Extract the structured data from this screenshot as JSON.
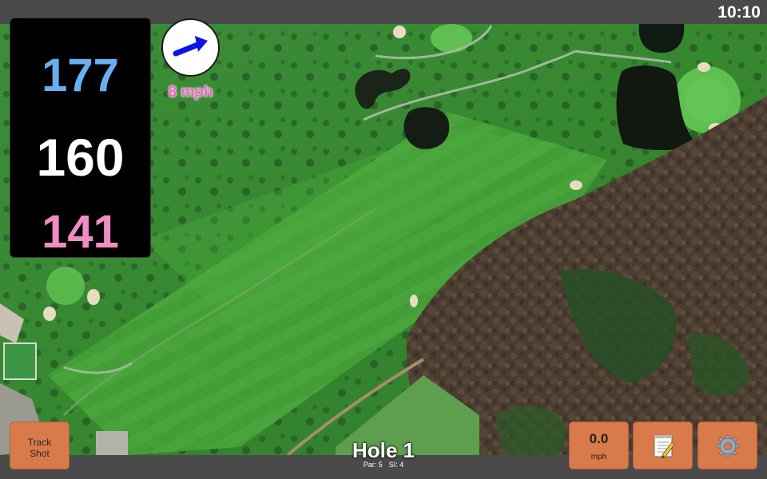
{
  "status_bar": {
    "time": "10:10"
  },
  "distances": {
    "back": "177",
    "center": "160",
    "front": "141"
  },
  "wind": {
    "speed": "8 mph",
    "icon": "wind-direction-arrow-icon",
    "arrow_color": "#0a14e6"
  },
  "buttons": {
    "track_shot_line1": "Track",
    "track_shot_line2": "Shot",
    "speed_value": "0.0",
    "speed_unit": "mph",
    "notes_icon": "notepad-icon",
    "settings_icon": "gear-icon"
  },
  "hole": {
    "title": "Hole 1",
    "par": "Par: 5",
    "si": "SI: 4"
  },
  "colors": {
    "back_distance": "#6aaef0",
    "center_distance": "#ffffff",
    "front_distance": "#f08cc4",
    "wind_speed_text": "#ff5fc8",
    "button_bg": "#d97a4a",
    "bar_bg": "#4a4a4a"
  }
}
